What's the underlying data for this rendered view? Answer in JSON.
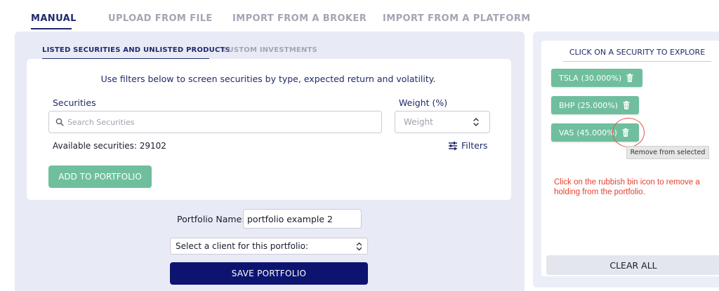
{
  "top_tabs": [
    {
      "label": "MANUAL",
      "active": true
    },
    {
      "label": "UPLOAD FROM FILE",
      "active": false
    },
    {
      "label": "IMPORT FROM A BROKER",
      "active": false
    },
    {
      "label": "IMPORT FROM A PLATFORM",
      "active": false
    }
  ],
  "sub_tabs": [
    {
      "label": "LISTED SECURITIES AND UNLISTED PRODUCTS",
      "active": true
    },
    {
      "label": "CUSTOM INVESTMENTS",
      "active": false
    }
  ],
  "filter_card": {
    "hint": "Use filters below to screen securities by type, expected return and volatility.",
    "securities_label": "Securities",
    "search_placeholder": "Search Securities",
    "weight_label": "Weight (%)",
    "weight_placeholder": "Weight",
    "available_text": "Available securities: 29102",
    "filters_label": "Filters",
    "add_button": "ADD TO PORTFOLIO"
  },
  "portfolio_form": {
    "name_label": "Portfolio Name:",
    "name_value": "portfolio example 2",
    "client_select_value": "Select a client for this portfolio:",
    "save_button": "SAVE PORTFOLIO"
  },
  "selected_panel": {
    "title": "CLICK ON A SECURITY TO EXPLORE",
    "chips": [
      {
        "ticker": "TSLA",
        "weight": "(30.000%)"
      },
      {
        "ticker": "BHP",
        "weight": "(25.000%)"
      },
      {
        "ticker": "VAS",
        "weight": "(45.000%)"
      }
    ],
    "tooltip": "Remove from selected",
    "annotation": "Click on the rubbish bin icon to remove a holding from the portfolio.",
    "clear_button": "CLEAR ALL"
  },
  "colors": {
    "navy": "#1f2a6b",
    "save_button": "#0d1470",
    "chip_green": "#6fbf9e",
    "annotation_red": "#e5402f",
    "panel_bg": "#e8eaf6"
  },
  "icons": {
    "search": "search-icon",
    "stepper": "chevron-up-down-icon",
    "filters": "sliders-icon",
    "trash": "trash-icon",
    "select_chevron": "chevron-up-down-icon"
  }
}
